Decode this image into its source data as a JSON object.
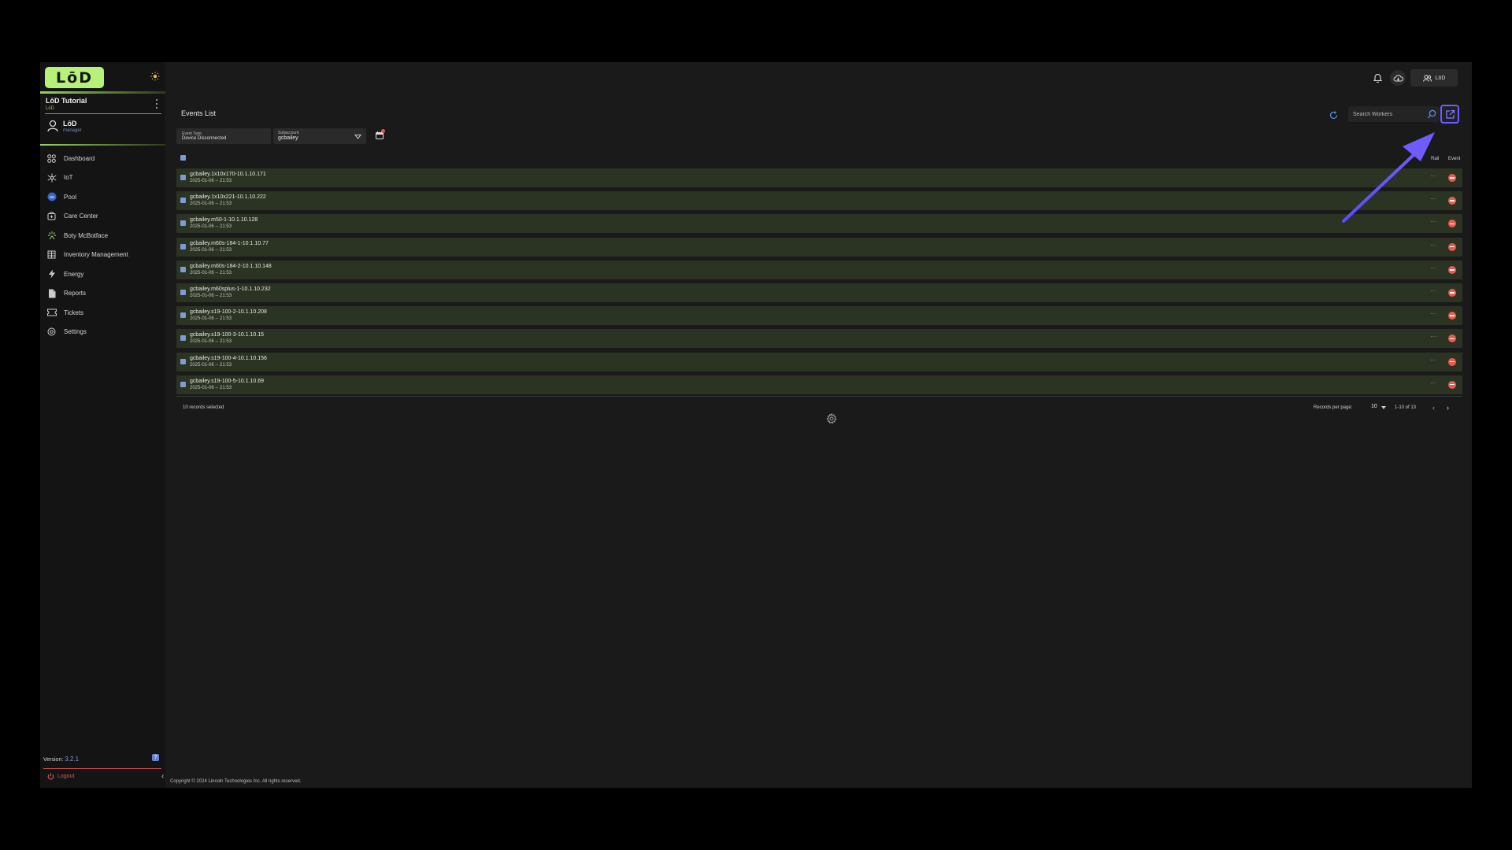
{
  "brand": {
    "logo_text": "LōD"
  },
  "org": {
    "name": "LōD Tutorial",
    "sub": "LōD"
  },
  "user": {
    "name": "LōD",
    "role": "manager"
  },
  "nav": {
    "items": [
      {
        "label": "Dashboard",
        "icon": "dashboard-icon"
      },
      {
        "label": "IoT",
        "icon": "iot-icon"
      },
      {
        "label": "Pool",
        "icon": "pool-icon"
      },
      {
        "label": "Care Center",
        "icon": "care-center-icon"
      },
      {
        "label": "Boty McBotface",
        "icon": "bot-icon"
      },
      {
        "label": "Inventory Management",
        "icon": "inventory-icon"
      },
      {
        "label": "Energy",
        "icon": "energy-icon"
      },
      {
        "label": "Reports",
        "icon": "reports-icon"
      },
      {
        "label": "Tickets",
        "icon": "tickets-icon"
      },
      {
        "label": "Settings",
        "icon": "settings-icon"
      }
    ]
  },
  "sidebar_footer": {
    "version_label": "Version:",
    "version": "3.2.1",
    "logout": "Logout"
  },
  "topbar": {
    "account_label": "LōD"
  },
  "events": {
    "title": "Events List",
    "search_placeholder": "Search Workers",
    "filters": {
      "event_type_label": "Event Type",
      "event_type_value": "Device Disconnected",
      "subaccount_label": "Subaccount",
      "subaccount_value": "gcbailey"
    },
    "columns": {
      "rail": "Rail",
      "event": "Event"
    },
    "rows": [
      {
        "name": "gcbailey.1x10x170-10.1.10.171",
        "time": "2025-01-06 -- 21:53"
      },
      {
        "name": "gcbailey.1x10x221-10.1.10.222",
        "time": "2025-01-06 -- 21:53"
      },
      {
        "name": "gcbailey.m50-1-10.1.10.128",
        "time": "2025-01-06 -- 21:53"
      },
      {
        "name": "gcbailey.m60s-184-1-10.1.10.77",
        "time": "2025-01-06 -- 21:53"
      },
      {
        "name": "gcbailey.m60s-184-2-10.1.10.148",
        "time": "2025-01-06 -- 21:53"
      },
      {
        "name": "gcbailey.m60splus-1-10.1.10.232",
        "time": "2025-01-06 -- 21:53"
      },
      {
        "name": "gcbailey.s19-100-2-10.1.10.208",
        "time": "2025-01-06 -- 21:53"
      },
      {
        "name": "gcbailey.s19-100-3-10.1.10.15",
        "time": "2025-01-06 -- 21:53"
      },
      {
        "name": "gcbailey.s19-100-4-10.1.10.156",
        "time": "2025-01-06 -- 21:53"
      },
      {
        "name": "gcbailey.s19-100-5-10.1.10.69",
        "time": "2025-01-06 -- 21:53"
      }
    ],
    "row_menu": "···",
    "footer": {
      "selected": "10 records selected",
      "records_per_page_label": "Records per page:",
      "records_per_page": "10",
      "range": "1-10 of 13",
      "prev": "‹",
      "next": "›"
    }
  },
  "copyright": "Copyright © 2024 Lincoln Technologies Inc. All rights reserved.",
  "colors": {
    "accent_green": "#b6f27a",
    "row_bg": "#2b3323",
    "highlight": "#6d5cff",
    "remove_red": "#ea5b4f"
  }
}
